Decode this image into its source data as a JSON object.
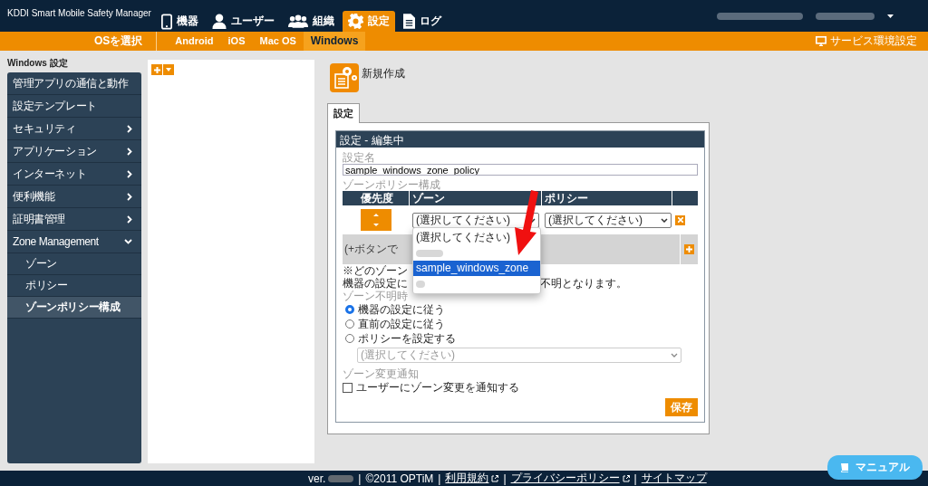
{
  "app": {
    "title": "KDDI Smart Mobile Safety Manager"
  },
  "nav": [
    {
      "label": "機器",
      "selected": false
    },
    {
      "label": "ユーザー",
      "selected": false
    },
    {
      "label": "組織",
      "selected": false
    },
    {
      "label": "設定",
      "selected": true
    },
    {
      "label": "ログ",
      "selected": false
    }
  ],
  "os_bar": {
    "label": "OSを選択",
    "tabs": [
      {
        "label": "Android",
        "selected": false
      },
      {
        "label": "iOS",
        "selected": false
      },
      {
        "label": "Mac OS",
        "selected": false
      },
      {
        "label": "Windows",
        "selected": true
      }
    ],
    "service_link": "サービス環境設定"
  },
  "sidebar": {
    "title": "Windows 設定",
    "items": [
      {
        "label": "管理アプリの通信と動作",
        "kind": "leaf"
      },
      {
        "label": "設定テンプレート",
        "kind": "leaf"
      },
      {
        "label": "セキュリティ",
        "kind": "group",
        "expanded": false
      },
      {
        "label": "アプリケーション",
        "kind": "group",
        "expanded": false
      },
      {
        "label": "インターネット",
        "kind": "group",
        "expanded": false
      },
      {
        "label": "便利機能",
        "kind": "group",
        "expanded": false
      },
      {
        "label": "証明書管理",
        "kind": "group",
        "expanded": false
      },
      {
        "label": "Zone Management",
        "kind": "group",
        "expanded": true,
        "children": [
          {
            "label": "ゾーン",
            "selected": false
          },
          {
            "label": "ポリシー",
            "selected": false
          },
          {
            "label": "ゾーンポリシー構成",
            "selected": true
          }
        ]
      }
    ]
  },
  "page": {
    "title": "新規作成",
    "tabs": [
      {
        "label": "設定",
        "selected": true
      }
    ],
    "form": {
      "header": "設定 - 編集中",
      "name_label": "設定名",
      "name_value": "sample_windows_zone_policy",
      "table_label": "ゾーンポリシー構成",
      "columns": [
        "優先度",
        "ゾーン",
        "ポリシー"
      ],
      "row": {
        "zone": "(選択してください)",
        "policy": "(選択してください)"
      },
      "add_hint": "(+ボタンで",
      "dropdown": [
        {
          "kind": "text",
          "label": "(選択してください)",
          "selected": false
        },
        {
          "kind": "redacted",
          "selected": false
        },
        {
          "kind": "text",
          "label": "sample_windows_zone",
          "selected": true
        },
        {
          "kind": "redacted",
          "selected": false
        }
      ],
      "note_1": "※どのゾーン",
      "note_2a": "機器の設定に",
      "note_2b": "不明となります。",
      "unknown_label": "ゾーン不明時",
      "radios": [
        {
          "label": "機器の設定に従う",
          "selected": true
        },
        {
          "label": "直前の設定に従う",
          "selected": false
        },
        {
          "label": "ポリシーを設定する",
          "selected": false
        }
      ],
      "policy_select": {
        "value": "(選択してください)",
        "disabled": true
      },
      "notify_label": "ゾーン変更通知",
      "notify": {
        "label": "ユーザーにゾーン変更を通知する",
        "checked": false
      },
      "save": "保存"
    }
  },
  "footer": [
    {
      "kind": "version",
      "text": "ver."
    },
    {
      "kind": "sep",
      "text": "|"
    },
    {
      "kind": "text",
      "text": "©2011 OPTiM"
    },
    {
      "kind": "sep",
      "text": "|"
    },
    {
      "kind": "link",
      "text": "利用規約",
      "external": true
    },
    {
      "kind": "sep",
      "text": "|"
    },
    {
      "kind": "link",
      "text": "プライバシーポリシー",
      "external": true
    },
    {
      "kind": "sep",
      "text": "|"
    },
    {
      "kind": "link",
      "text": "サイトマップ",
      "external": false
    }
  ],
  "manual_button": "マニュアル"
}
